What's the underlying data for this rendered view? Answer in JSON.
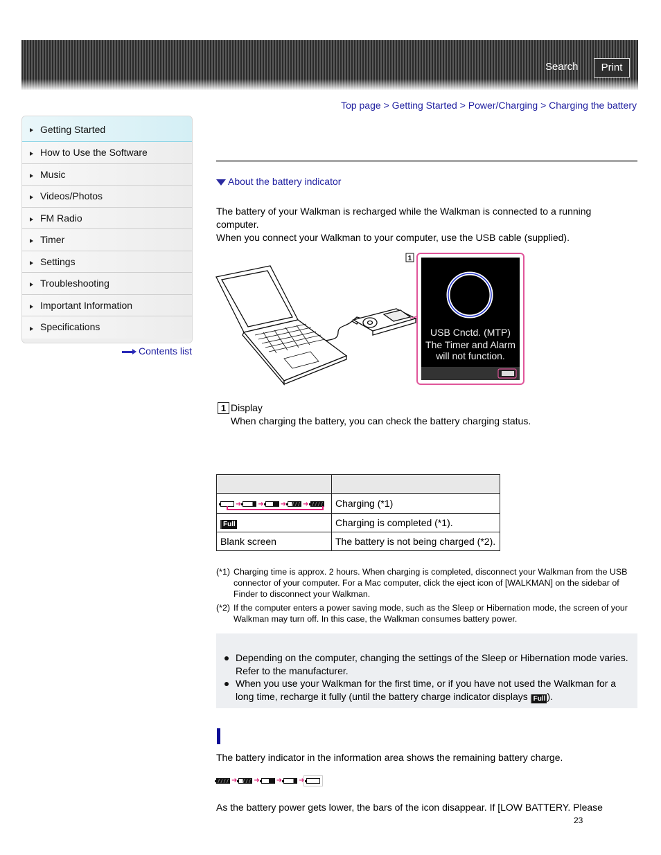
{
  "header": {
    "search_label": "Search",
    "print_label": "Print"
  },
  "sidebar": {
    "items": [
      {
        "label": "Getting Started",
        "active": true
      },
      {
        "label": "How to Use the Software"
      },
      {
        "label": "Music"
      },
      {
        "label": "Videos/Photos"
      },
      {
        "label": "FM Radio"
      },
      {
        "label": "Timer"
      },
      {
        "label": "Settings"
      },
      {
        "label": "Troubleshooting"
      },
      {
        "label": "Important Information"
      },
      {
        "label": "Specifications"
      }
    ],
    "contents_list_label": "Contents list"
  },
  "breadcrumb": {
    "items": [
      "Top page",
      "Getting Started",
      "Power/Charging",
      "Charging the battery"
    ],
    "separator": ">"
  },
  "main": {
    "anchor_link": "About the battery indicator",
    "intro_line1": "The battery of your Walkman is recharged while the Walkman is connected to a running",
    "intro_line2": "computer.",
    "intro_line3": "When you connect your Walkman to your computer, use the USB cable (supplied).",
    "illustration": {
      "callout_number": "1",
      "screen_line1": "USB Cnctd. (MTP)",
      "screen_line2": "The Timer and Alarm",
      "screen_line3": "will not function."
    },
    "display_item": {
      "number": "1",
      "title": "Display",
      "description": "When charging the battery, you can check the battery charging status."
    },
    "status_table": {
      "header": [
        "",
        ""
      ],
      "rows": [
        {
          "indicator": "charging-sequence-icons",
          "description": "Charging (*1)"
        },
        {
          "indicator": "Full",
          "description": "Charging is completed (*1)."
        },
        {
          "indicator": "Blank screen",
          "description": "The battery is not being charged (*2)."
        }
      ]
    },
    "footnotes": [
      {
        "id": "(*1)",
        "text": "Charging time is approx. 2 hours. When charging is completed, disconnect your Walkman from the USB connector of your computer. For a Mac computer, click the eject icon of [WALKMAN] on the sidebar of Finder to disconnect your Walkman."
      },
      {
        "id": "(*2)",
        "text": "If the computer enters a power saving mode, such as the Sleep or Hibernation mode, the screen of your Walkman may turn off. In this case, the Walkman consumes battery power."
      }
    ],
    "notes": [
      {
        "text": "Depending on the computer, changing the settings of the Sleep or Hibernation mode varies. Refer to the manufacturer."
      },
      {
        "text_before": "When you use your Walkman for the first time, or if you have not used the Walkman for a long time, recharge it fully (until the battery charge indicator displays ",
        "icon": "Full",
        "text_after": ")."
      }
    ],
    "battery_section": {
      "intro": "The battery indicator in the information area shows the remaining battery charge.",
      "trailing_text": "As the battery power gets lower, the bars of the icon disappear. If [LOW BATTERY. Please"
    }
  },
  "colors": {
    "link": "#1f1fa0",
    "accent_pink": "#e0207a",
    "section_bar": "#0c0c96",
    "note_bg": "#edeff2"
  },
  "page_number": "23"
}
